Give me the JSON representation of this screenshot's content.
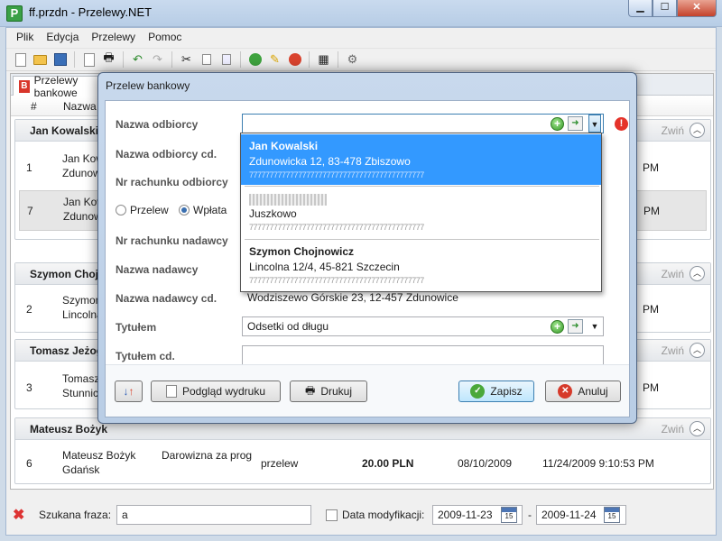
{
  "window": {
    "title": "ff.przdn - Przelewy.NET",
    "icon_letter": "P"
  },
  "menu": [
    "Plik",
    "Edycja",
    "Przelewy",
    "Pomoc"
  ],
  "tabs": {
    "active": "Przelewy bankowe"
  },
  "columns": {
    "num": "#",
    "name": "Nazwa o"
  },
  "groups": [
    {
      "name": "Jan Kowalski",
      "collapse": "Zwiń",
      "rows": [
        {
          "num": "1",
          "line1": "Jan Kowa",
          "line2": "Zdunowi",
          "right": "PM"
        },
        {
          "num": "7",
          "line1": "Jan Kowa",
          "line2": "Zdunowi",
          "right": "PM"
        }
      ]
    },
    {
      "name": "Szymon Chojn",
      "collapse": "Zwiń",
      "rows": [
        {
          "num": "2",
          "line1": "Szymon",
          "line2": "Lincolna",
          "right": "PM"
        }
      ]
    },
    {
      "name": "Tomasz Jeżog",
      "collapse": "Zwiń",
      "rows": [
        {
          "num": "3",
          "line1": "Tomasz",
          "line2": "Stunnick",
          "right": "PM"
        }
      ]
    },
    {
      "name": "Mateusz Bożyk",
      "collapse": "Zwiń",
      "rows": [
        {
          "num": "6",
          "line1": "Mateusz Bożyk",
          "line2": "Gdańsk",
          "title": "Darowizna za prog",
          "type": "przelew",
          "amount": "20.00 PLN",
          "date": "08/10/2009",
          "modified": "11/24/2009 9:10:53 PM"
        }
      ]
    }
  ],
  "search": {
    "label": "Szukana fraza:",
    "value": "a",
    "date_checkbox_label": "Data modyfikacji:",
    "date_from": "2009-11-23",
    "date_to": "2009-11-24",
    "dash": "-",
    "cal_day": "15"
  },
  "dialog": {
    "title": "Przelew bankowy",
    "labels": {
      "recipient": "Nazwa odbiorcy",
      "recipient_cd": "Nazwa odbiorcy cd.",
      "recipient_account": "Nr rachunku odbiorcy",
      "sender_account": "Nr rachunku nadawcy",
      "sender_name": "Nazwa nadawcy",
      "sender_name_cd": "Nazwa nadawcy cd.",
      "title": "Tytułem",
      "title_cd": "Tytułem cd."
    },
    "values": {
      "recipient": "",
      "sender_name_cd": "Wodziszewo Górskie 23, 12-457 Zdunowice",
      "title": "Odsetki od długu",
      "title_cd": ""
    },
    "radios": {
      "przelew": "Przelew",
      "wplata": "Wpłata",
      "selected": "wplata"
    },
    "buttons": {
      "preview": "Podgląd wydruku",
      "print": "Drukuj",
      "save": "Zapisz",
      "cancel": "Anuluj"
    }
  },
  "dropdown": [
    {
      "name": "Jan Kowalski",
      "address": "Zdunowicka 12, 83-478 Zbiszowo",
      "highlighted": true
    },
    {
      "name": "",
      "address": "Juszkowo",
      "highlighted": false
    },
    {
      "name": "Szymon Chojnowicz",
      "address": "Lincolna 12/4, 45-821 Szczecin",
      "highlighted": false
    }
  ]
}
